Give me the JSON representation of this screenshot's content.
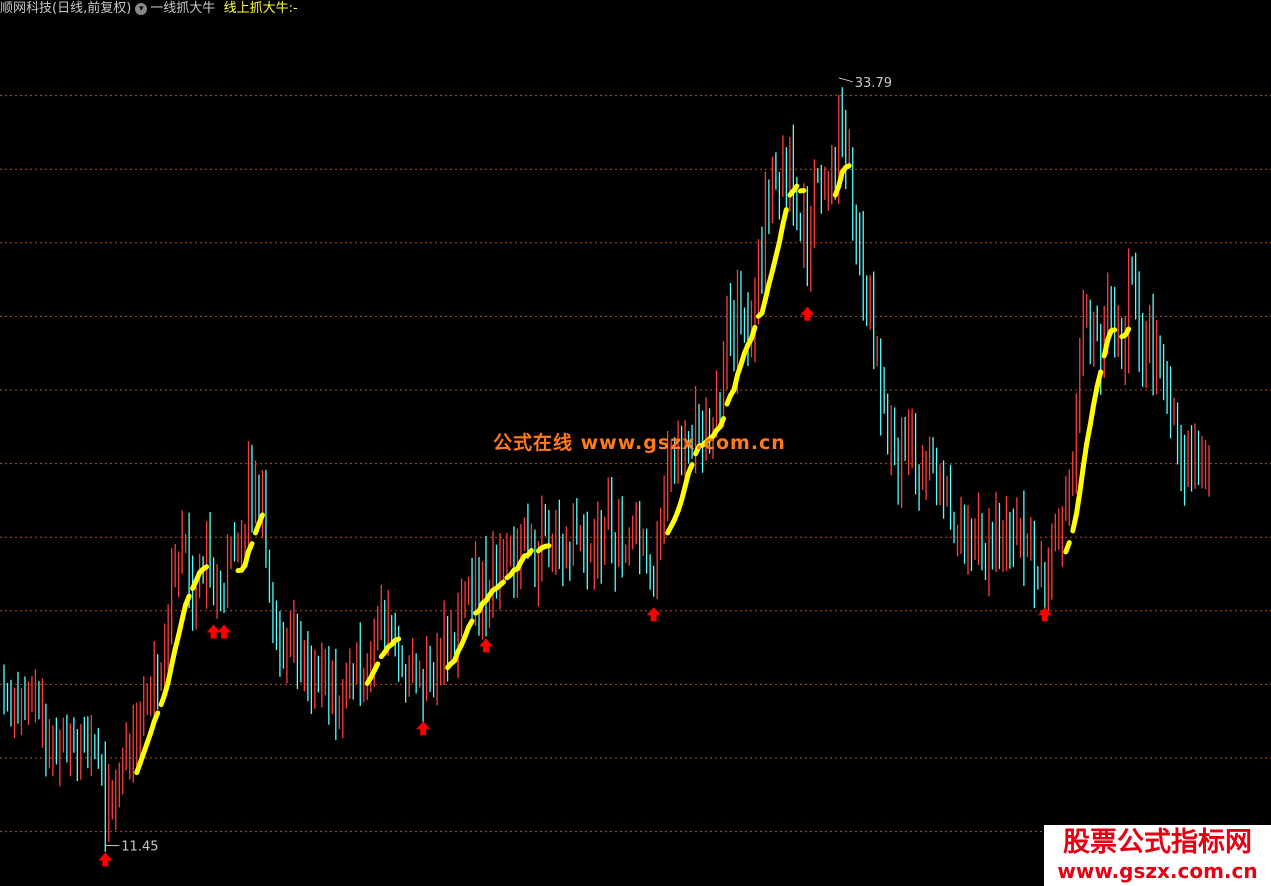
{
  "header": {
    "stock_title": "顺网科技(日线,前复权)",
    "gear_icon": "gear-icon",
    "indicator_name": "一线抓大牛",
    "indicator_value": "线上抓大牛:-"
  },
  "watermark": "公式在线 www.gszx.com.cn",
  "logo": {
    "line1": "股票公式指标网",
    "line2": "www.gszx.com.cn"
  },
  "colors": {
    "up": "#ff3c3c",
    "down": "#54ffff",
    "line": "#ffff00",
    "grid": "#b0561b",
    "signal": "#ff0000",
    "text": "#c8c8c8"
  },
  "chart_data": {
    "type": "candlestick",
    "title": "顺网科技(日线,前复权)",
    "ylim": [
      10.8,
      35.0
    ],
    "max_label": {
      "value": "33.79",
      "index": 239
    },
    "min_label": {
      "value": "11.45",
      "index": 29
    },
    "closes": [
      15.9,
      15.7,
      15.5,
      15.8,
      15.5,
      15.6,
      15.3,
      15.6,
      15.6,
      15.9,
      15.3,
      15.3,
      14.0,
      14.1,
      14.4,
      14.2,
      14.5,
      14.6,
      14.3,
      14.7,
      14.6,
      14.3,
      14.6,
      14.5,
      14.2,
      14.4,
      14.3,
      13.9,
      13.7,
      12.0,
      12.8,
      12.8,
      13.1,
      13.3,
      13.9,
      14.2,
      14.3,
      14.6,
      14.6,
      14.8,
      15.7,
      15.7,
      16.0,
      16.6,
      16.4,
      16.6,
      17.2,
      18.2,
      19.5,
      19.5,
      19.7,
      20.2,
      20.3,
      19.1,
      18.6,
      18.8,
      19.6,
      19.2,
      20.2,
      19.2,
      18.6,
      19.2,
      18.7,
      18.6,
      19.6,
      20.1,
      19.9,
      20.0,
      20.3,
      20.6,
      22.6,
      21.5,
      21.8,
      21.3,
      22.1,
      19.7,
      18.9,
      18.0,
      17.6,
      17.3,
      17.1,
      17.5,
      17.5,
      17.6,
      17.0,
      16.7,
      16.8,
      16.6,
      16.3,
      16.4,
      16.1,
      16.3,
      16.4,
      15.8,
      16.2,
      15.3,
      15.6,
      15.7,
      16.0,
      16.4,
      16.3,
      16.9,
      16.1,
      16.4,
      16.7,
      17.0,
      17.6,
      17.7,
      18.1,
      17.6,
      17.9,
      17.6,
      17.3,
      16.8,
      16.5,
      16.4,
      16.4,
      16.5,
      16.2,
      16.3,
      15.8,
      16.6,
      16.3,
      16.1,
      16.8,
      17.1,
      17.6,
      17.2,
      17.4,
      17.1,
      18.5,
      18.5,
      18.7,
      18.8,
      18.6,
      19.4,
      18.2,
      19.4,
      18.2,
      18.7,
      19.9,
      19.1,
      19.6,
      19.7,
      19.8,
      20.2,
      19.6,
      19.8,
      20.2,
      20.4,
      20.2,
      20.4,
      19.4,
      19.8,
      20.7,
      20.6,
      19.8,
      19.9,
      20.8,
      19.8,
      19.7,
      20.1,
      19.7,
      20.8,
      20.4,
      20.5,
      20.1,
      19.8,
      19.9,
      20.0,
      20.5,
      20.0,
      20.8,
      21.4,
      20.1,
      19.8,
      20.8,
      20.0,
      20.0,
      20.4,
      20.8,
      20.8,
      20.3,
      20.4,
      19.6,
      19.3,
      19.1,
      20.6,
      20.8,
      21.6,
      22.5,
      22.7,
      22.3,
      22.9,
      22.7,
      23.2,
      23.1,
      23.0,
      23.9,
      23.8,
      22.8,
      23.6,
      23.2,
      23.7,
      24.4,
      24.2,
      25.5,
      27.2,
      26.4,
      25.4,
      27.1,
      26.6,
      26.5,
      26.1,
      26.3,
      27.4,
      28.7,
      28.1,
      30.5,
      29.7,
      30.9,
      30.8,
      30.6,
      31.3,
      30.6,
      31.6,
      29.9,
      29.5,
      29.1,
      29.8,
      27.8,
      29.8,
      30.9,
      30.8,
      30.4,
      30.4,
      30.6,
      31.5,
      30.8,
      32.4,
      31.8,
      31.2,
      31.4,
      29.4,
      29.1,
      28.8,
      27.6,
      26.8,
      27.2,
      25.7,
      25.7,
      24.3,
      24.1,
      23.2,
      23.3,
      22.8,
      22.1,
      23.2,
      23.0,
      23.2,
      23.2,
      22.3,
      22.0,
      22.0,
      22.3,
      22.8,
      22.6,
      21.6,
      22.2,
      21.5,
      21.7,
      20.9,
      20.5,
      20.5,
      21.1,
      20.3,
      20.4,
      20.0,
      20.2,
      20.7,
      20.0,
      19.4,
      20.5,
      20.3,
      20.9,
      20.2,
      20.2,
      20.6,
      20.4,
      20.3,
      20.5,
      20.7,
      20.0,
      20.1,
      20.1,
      19.3,
      19.2,
      19.4,
      19.1,
      19.2,
      20.2,
      20.3,
      20.4,
      21.0,
      21.4,
      22.0,
      22.6,
      24.0,
      25.5,
      26.7,
      27.0,
      25.7,
      26.4,
      26.2,
      25.5,
      26.6,
      27.3,
      26.6,
      25.8,
      26.2,
      25.5,
      26.1,
      28.2,
      28.0,
      27.2,
      26.0,
      25.5,
      26.4,
      26.7,
      25.5,
      25.9,
      25.8,
      24.8,
      24.4,
      23.9,
      24.0,
      22.9,
      22.5,
      22.1,
      22.7,
      22.3,
      22.8,
      22.2,
      22.4,
      22.4,
      22.8
    ]
  }
}
